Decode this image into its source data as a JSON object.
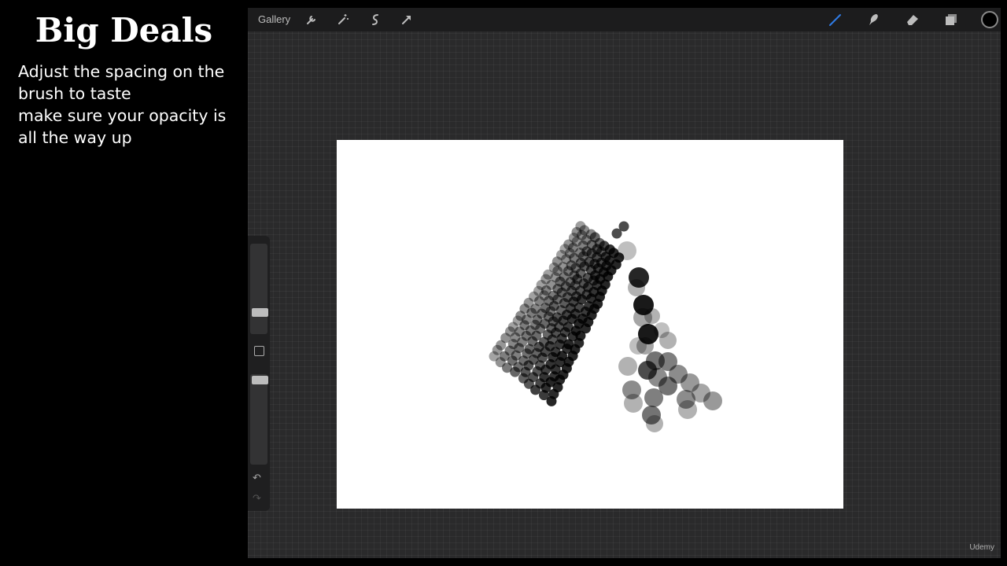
{
  "slide": {
    "title": "Big Deals",
    "lines": [
      "Adjust the spacing on the",
      "brush to taste",
      "make sure your opacity is",
      "all the way up"
    ]
  },
  "toolbar": {
    "gallery_label": "Gallery",
    "left_tools": [
      "wrench-icon",
      "magic-wand-icon",
      "selection-icon",
      "transform-arrow-icon"
    ],
    "right_tools": [
      "brush-icon",
      "smudge-icon",
      "eraser-icon",
      "layers-icon"
    ],
    "active_tool": "brush-icon",
    "active_color": "#000000",
    "accent": "#2f7be5"
  },
  "sidebar": {
    "brush_size_level": 0.2,
    "opacity_level": 1.0,
    "undo_icon": "undo-icon",
    "redo_icon": "redo-icon"
  },
  "watermark": {
    "text": "Udemy"
  }
}
